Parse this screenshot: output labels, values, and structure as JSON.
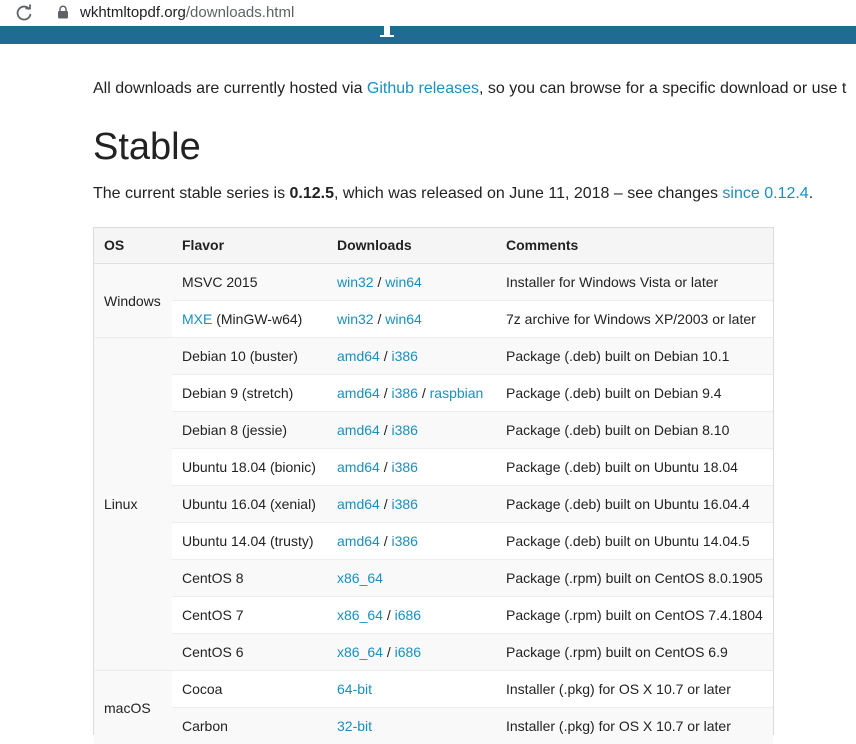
{
  "browser": {
    "url_host": "wkhtmltopdf.org",
    "url_path": "/downloads.html"
  },
  "intro": {
    "before": "All downloads are currently hosted via ",
    "link": "Github releases",
    "after": ", so you can browse for a specific download or use t"
  },
  "heading": "Stable",
  "series": {
    "before": "The current stable series is ",
    "version": "0.12.5",
    "middle": ", which was released on June 11, 2018 – see changes ",
    "link": "since 0.12.4",
    "after": "."
  },
  "table": {
    "headers": {
      "os": "OS",
      "flavor": "Flavor",
      "downloads": "Downloads",
      "comments": "Comments"
    },
    "sep": "/",
    "groups": {
      "windows": "Windows",
      "linux": "Linux",
      "macos": "macOS"
    },
    "rows": [
      {
        "flavor": "MSVC 2015",
        "d1": "win32",
        "d2": "win64",
        "comment": "Installer for Windows Vista or later"
      },
      {
        "flavor_link": "MXE",
        "flavor_rest": " (MinGW-w64)",
        "d1": "win32",
        "d2": "win64",
        "comment": "7z archive for Windows XP/2003 or later"
      },
      {
        "flavor": "Debian 10 (buster)",
        "d1": "amd64",
        "d2": "i386",
        "comment": "Package (.deb) built on Debian 10.1"
      },
      {
        "flavor": "Debian 9 (stretch)",
        "d1": "amd64",
        "d2": "i386",
        "d3": "raspbian",
        "comment": "Package (.deb) built on Debian 9.4"
      },
      {
        "flavor": "Debian 8 (jessie)",
        "d1": "amd64",
        "d2": "i386",
        "comment": "Package (.deb) built on Debian 8.10"
      },
      {
        "flavor": "Ubuntu 18.04 (bionic)",
        "d1": "amd64",
        "d2": "i386",
        "comment": "Package (.deb) built on Ubuntu 18.04"
      },
      {
        "flavor": "Ubuntu 16.04 (xenial)",
        "d1": "amd64",
        "d2": "i386",
        "comment": "Package (.deb) built on Ubuntu 16.04.4"
      },
      {
        "flavor": "Ubuntu 14.04 (trusty)",
        "d1": "amd64",
        "d2": "i386",
        "comment": "Package (.deb) built on Ubuntu 14.04.5"
      },
      {
        "flavor": "CentOS 8",
        "d1": "x86_64",
        "comment": "Package (.rpm) built on CentOS 8.0.1905"
      },
      {
        "flavor": "CentOS 7",
        "d1": "x86_64",
        "d2": "i686",
        "comment": "Package (.rpm) built on CentOS 7.4.1804"
      },
      {
        "flavor": "CentOS 6",
        "d1": "x86_64",
        "d2": "i686",
        "comment": "Package (.rpm) built on CentOS 6.9"
      },
      {
        "flavor": "Cocoa",
        "d1": "64-bit",
        "comment": "Installer (.pkg) for OS X 10.7 or later"
      },
      {
        "flavor": "Carbon",
        "d1": "32-bit",
        "comment": "Installer (.pkg) for OS X 10.7 or later"
      }
    ]
  },
  "colors": {
    "link": "#1a8fbf",
    "banner": "#1f6b94"
  },
  "icons": [
    "reload-icon",
    "lock-icon"
  ]
}
